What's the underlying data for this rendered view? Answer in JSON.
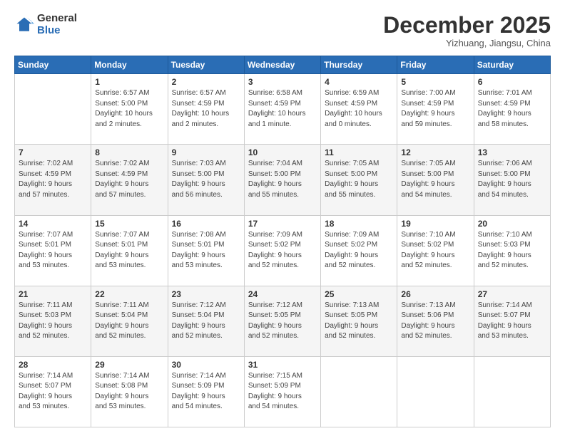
{
  "logo": {
    "general": "General",
    "blue": "Blue"
  },
  "header": {
    "month": "December 2025",
    "location": "Yizhuang, Jiangsu, China"
  },
  "weekdays": [
    "Sunday",
    "Monday",
    "Tuesday",
    "Wednesday",
    "Thursday",
    "Friday",
    "Saturday"
  ],
  "weeks": [
    [
      {
        "day": "",
        "info": ""
      },
      {
        "day": "1",
        "info": "Sunrise: 6:57 AM\nSunset: 5:00 PM\nDaylight: 10 hours\nand 2 minutes."
      },
      {
        "day": "2",
        "info": "Sunrise: 6:57 AM\nSunset: 4:59 PM\nDaylight: 10 hours\nand 2 minutes."
      },
      {
        "day": "3",
        "info": "Sunrise: 6:58 AM\nSunset: 4:59 PM\nDaylight: 10 hours\nand 1 minute."
      },
      {
        "day": "4",
        "info": "Sunrise: 6:59 AM\nSunset: 4:59 PM\nDaylight: 10 hours\nand 0 minutes."
      },
      {
        "day": "5",
        "info": "Sunrise: 7:00 AM\nSunset: 4:59 PM\nDaylight: 9 hours\nand 59 minutes."
      },
      {
        "day": "6",
        "info": "Sunrise: 7:01 AM\nSunset: 4:59 PM\nDaylight: 9 hours\nand 58 minutes."
      }
    ],
    [
      {
        "day": "7",
        "info": "Sunrise: 7:02 AM\nSunset: 4:59 PM\nDaylight: 9 hours\nand 57 minutes."
      },
      {
        "day": "8",
        "info": "Sunrise: 7:02 AM\nSunset: 4:59 PM\nDaylight: 9 hours\nand 57 minutes."
      },
      {
        "day": "9",
        "info": "Sunrise: 7:03 AM\nSunset: 5:00 PM\nDaylight: 9 hours\nand 56 minutes."
      },
      {
        "day": "10",
        "info": "Sunrise: 7:04 AM\nSunset: 5:00 PM\nDaylight: 9 hours\nand 55 minutes."
      },
      {
        "day": "11",
        "info": "Sunrise: 7:05 AM\nSunset: 5:00 PM\nDaylight: 9 hours\nand 55 minutes."
      },
      {
        "day": "12",
        "info": "Sunrise: 7:05 AM\nSunset: 5:00 PM\nDaylight: 9 hours\nand 54 minutes."
      },
      {
        "day": "13",
        "info": "Sunrise: 7:06 AM\nSunset: 5:00 PM\nDaylight: 9 hours\nand 54 minutes."
      }
    ],
    [
      {
        "day": "14",
        "info": "Sunrise: 7:07 AM\nSunset: 5:01 PM\nDaylight: 9 hours\nand 53 minutes."
      },
      {
        "day": "15",
        "info": "Sunrise: 7:07 AM\nSunset: 5:01 PM\nDaylight: 9 hours\nand 53 minutes."
      },
      {
        "day": "16",
        "info": "Sunrise: 7:08 AM\nSunset: 5:01 PM\nDaylight: 9 hours\nand 53 minutes."
      },
      {
        "day": "17",
        "info": "Sunrise: 7:09 AM\nSunset: 5:02 PM\nDaylight: 9 hours\nand 52 minutes."
      },
      {
        "day": "18",
        "info": "Sunrise: 7:09 AM\nSunset: 5:02 PM\nDaylight: 9 hours\nand 52 minutes."
      },
      {
        "day": "19",
        "info": "Sunrise: 7:10 AM\nSunset: 5:02 PM\nDaylight: 9 hours\nand 52 minutes."
      },
      {
        "day": "20",
        "info": "Sunrise: 7:10 AM\nSunset: 5:03 PM\nDaylight: 9 hours\nand 52 minutes."
      }
    ],
    [
      {
        "day": "21",
        "info": "Sunrise: 7:11 AM\nSunset: 5:03 PM\nDaylight: 9 hours\nand 52 minutes."
      },
      {
        "day": "22",
        "info": "Sunrise: 7:11 AM\nSunset: 5:04 PM\nDaylight: 9 hours\nand 52 minutes."
      },
      {
        "day": "23",
        "info": "Sunrise: 7:12 AM\nSunset: 5:04 PM\nDaylight: 9 hours\nand 52 minutes."
      },
      {
        "day": "24",
        "info": "Sunrise: 7:12 AM\nSunset: 5:05 PM\nDaylight: 9 hours\nand 52 minutes."
      },
      {
        "day": "25",
        "info": "Sunrise: 7:13 AM\nSunset: 5:05 PM\nDaylight: 9 hours\nand 52 minutes."
      },
      {
        "day": "26",
        "info": "Sunrise: 7:13 AM\nSunset: 5:06 PM\nDaylight: 9 hours\nand 52 minutes."
      },
      {
        "day": "27",
        "info": "Sunrise: 7:14 AM\nSunset: 5:07 PM\nDaylight: 9 hours\nand 53 minutes."
      }
    ],
    [
      {
        "day": "28",
        "info": "Sunrise: 7:14 AM\nSunset: 5:07 PM\nDaylight: 9 hours\nand 53 minutes."
      },
      {
        "day": "29",
        "info": "Sunrise: 7:14 AM\nSunset: 5:08 PM\nDaylight: 9 hours\nand 53 minutes."
      },
      {
        "day": "30",
        "info": "Sunrise: 7:14 AM\nSunset: 5:09 PM\nDaylight: 9 hours\nand 54 minutes."
      },
      {
        "day": "31",
        "info": "Sunrise: 7:15 AM\nSunset: 5:09 PM\nDaylight: 9 hours\nand 54 minutes."
      },
      {
        "day": "",
        "info": ""
      },
      {
        "day": "",
        "info": ""
      },
      {
        "day": "",
        "info": ""
      }
    ]
  ]
}
